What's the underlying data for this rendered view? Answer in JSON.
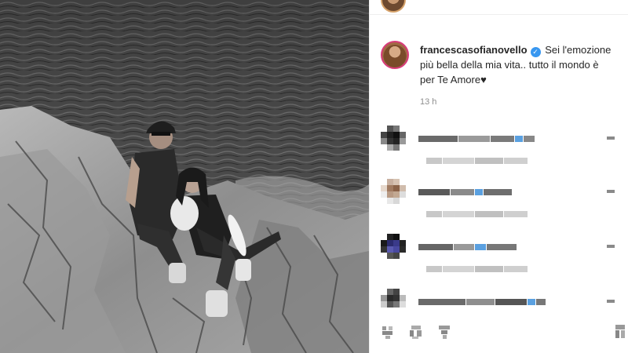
{
  "post": {
    "photo_alt": "black and white photo of a couple sitting on sea rocks",
    "author": {
      "username": "francescasofianovello",
      "verified_icon": "verified-check-icon"
    },
    "caption": "Sei l'emozione più bella della mia vita.. tutto il mondo è per Te Amore♥",
    "timestamp": "13 h"
  },
  "comments": [
    {
      "avatar_icon": "pixelated-avatar-icon",
      "text": "(pixelated)",
      "meta": "(pixelated)",
      "like_icon": "heart-icon"
    },
    {
      "avatar_icon": "pixelated-avatar-icon",
      "text": "(pixelated)",
      "meta": "(pixelated)",
      "like_icon": "heart-icon"
    },
    {
      "avatar_icon": "pixelated-avatar-icon",
      "text": "(pixelated)",
      "meta": "(pixelated)",
      "like_icon": "heart-icon"
    },
    {
      "avatar_icon": "pixelated-avatar-icon",
      "text": "(pixelated)",
      "meta": "(pixelated)",
      "like_icon": "heart-icon"
    }
  ],
  "actions": [
    {
      "icon": "heart-icon"
    },
    {
      "icon": "comment-icon"
    },
    {
      "icon": "share-icon"
    },
    {
      "icon": "bookmark-icon"
    }
  ],
  "colors": {
    "verified": "#3897f0",
    "story_ring": "#d93b7a",
    "muted_text": "#8e8e8e"
  }
}
